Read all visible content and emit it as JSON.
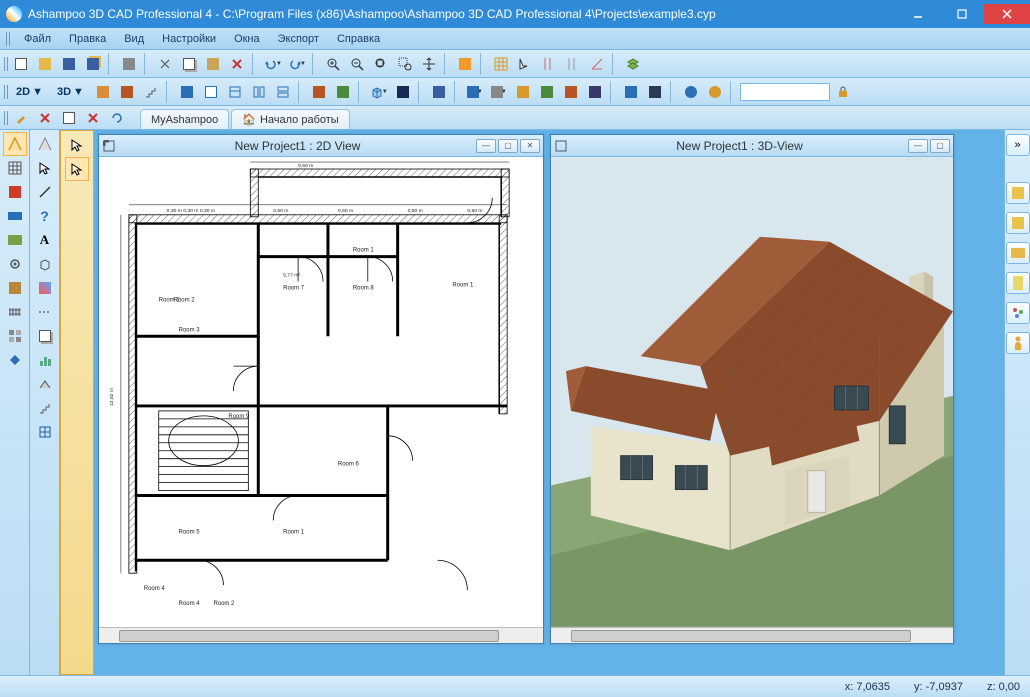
{
  "app": {
    "title": "Ashampoo 3D CAD Professional 4 - C:\\Program Files (x86)\\Ashampoo\\Ashampoo 3D CAD Professional 4\\Projects\\example3.cyp"
  },
  "menu": {
    "items": [
      "Файл",
      "Правка",
      "Вид",
      "Настройки",
      "Окна",
      "Экспорт",
      "Справка"
    ]
  },
  "tabs": {
    "items": [
      "MyAshampoo",
      "Начало работы"
    ]
  },
  "toolbarTop1": {
    "icons": [
      "new-icon",
      "open-icon",
      "save-icon",
      "save-as-icon",
      "print-icon",
      "sep",
      "cut-icon",
      "copy-icon",
      "paste-icon",
      "delete-icon",
      "sep",
      "undo-icon",
      "redo-icon",
      "sep",
      "zoom-in-icon",
      "zoom-out-icon",
      "zoom-fit-icon",
      "zoom-region-icon",
      "pan-icon",
      "sep",
      "toggle-ortho-icon",
      "sep",
      "grid-icon",
      "cursor-icon",
      "snap-icon",
      "snap-lines-icon",
      "snap-angles-icon",
      "sep",
      "layers-icon"
    ]
  },
  "toolbarTop2": {
    "txt2d": "2D",
    "txt3d": "3D",
    "icons": [
      "walls-icon",
      "roof-icon",
      "stairs-icon",
      "window-icon",
      "sep",
      "floor-a-icon",
      "floor-b-icon",
      "floor-c-icon",
      "floor-d-icon",
      "floor-e-icon",
      "sep",
      "view-a-icon",
      "view-b-icon",
      "sep",
      "cube-icon",
      "shade-icon",
      "sep",
      "stamp-icon",
      "sep",
      "color-fill-icon",
      "color-drop-icon",
      "material-a-icon",
      "material-b-icon",
      "material-c-icon",
      "furniture-icon",
      "sep",
      "dim-a-icon",
      "dim-b-icon",
      "sep",
      "globe-icon",
      "person-icon"
    ],
    "lockIcon": "lock-icon"
  },
  "smallToolbar": {
    "icons": [
      "hammer-icon",
      "wand-icon",
      "box-icon",
      "delete-sm-icon",
      "refresh-icon"
    ]
  },
  "leftColA": {
    "icons": [
      "nav-a-icon",
      "grid-icon",
      "wall-red-icon",
      "wall-blue-icon",
      "surface-icon",
      "gear-icon",
      "texture-icon",
      "fence-icon",
      "tile-icon",
      "shape-blue-icon"
    ]
  },
  "leftColB": {
    "icons": [
      "nav-b-icon",
      "cursor2-icon",
      "line-icon",
      "qmark-icon",
      "text-icon",
      "iso-icon",
      "paint-icon",
      "dash-icon",
      "copy2-icon",
      "chart-icon",
      "roof2-icon",
      "stairs2-icon",
      "window2-icon"
    ]
  },
  "leftColC": {
    "icons": [
      "select-arrow-icon",
      "select-box-icon"
    ]
  },
  "rightPanel": {
    "icons": [
      "expand-icon",
      "catalog-a-icon",
      "catalog-b-icon",
      "folder-icon",
      "clipboard-icon",
      "tree-icon",
      "person-y-icon"
    ]
  },
  "views": {
    "left": {
      "title": "New Project1 : 2D View"
    },
    "right": {
      "title": "New Project1 : 3D-View"
    }
  },
  "plan": {
    "dimTop": [
      "0,50 m",
      "0,50 m",
      "0,50 m",
      "0,50 m"
    ],
    "dimTopOuter": "0,50 m",
    "dimLeft": "12,82 m",
    "dimSegments": "0,30 m 0,30 m 0,30 m",
    "rooms": [
      "Room 1",
      "Room 2",
      "Room 2",
      "Room 3",
      "Room 4",
      "Room 4",
      "Room 5",
      "Room 6",
      "Room 7",
      "Room 8",
      "Room 9",
      "Room 1",
      "Room 1",
      "Room 2"
    ],
    "roomDim": "5,77 m²"
  },
  "status": {
    "x_label": "x:",
    "x_val": "7,0635",
    "y_label": "y:",
    "y_val": "-7,0937",
    "z_label": "z:",
    "z_val": "0,00"
  }
}
